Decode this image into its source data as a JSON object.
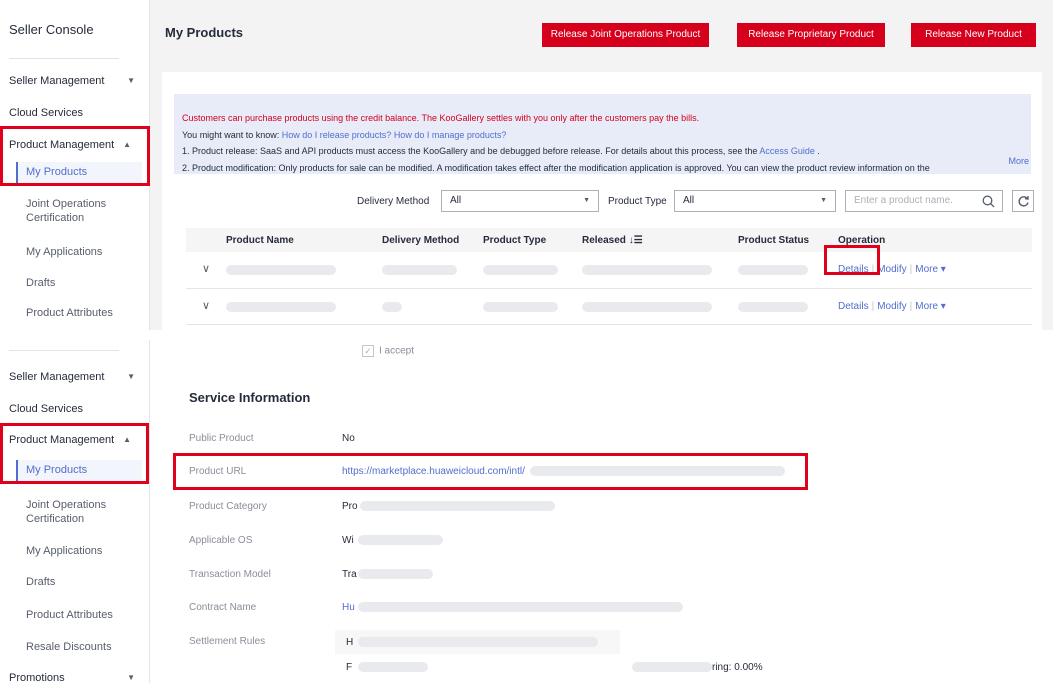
{
  "sidebar": {
    "title": "Seller Console",
    "items": {
      "seller_management": "Seller Management",
      "cloud_services": "Cloud Services",
      "product_management": "Product Management",
      "my_products": "My Products",
      "joint_ops_line1": "Joint Operations",
      "joint_ops_line2": "Certification",
      "my_applications": "My Applications",
      "drafts": "Drafts",
      "product_attributes": "Product Attributes",
      "resale_discounts": "Resale Discounts",
      "promotions": "Promotions"
    },
    "arrow_down": "▼",
    "arrow_up": "▲"
  },
  "header": {
    "title": "My Products",
    "btn_joint": "Release Joint Operations Product",
    "btn_proprietary": "Release Proprietary Product",
    "btn_new": "Release New Product"
  },
  "notice": {
    "line0": "Customers can purchase products using the credit balance. The KooGallery settles with you only after the customers pay the bills.",
    "line1_prefix": "You might want to know: ",
    "line1_link1": "How do I release products?",
    "line1_link2": "How do I manage products?",
    "line2_prefix": "1. Product release: SaaS and API products must access the KooGallery and be debugged before release. For details about this process, see the ",
    "line2_link": "Access Guide",
    "line2_suffix": " .",
    "line3": "2. Product modification: Only products for sale can be modified. A modification takes effect after the modification application is approved. You can view the product review information on the",
    "more": "More"
  },
  "filters": {
    "delivery_label": "Delivery Method",
    "delivery_value": "All",
    "type_label": "Product Type",
    "type_value": "All",
    "search_placeholder": "Enter a product name.",
    "search_icon": "search-icon",
    "refresh_icon": "refresh-icon",
    "caret": "▼"
  },
  "table": {
    "columns": {
      "name": "Product Name",
      "delivery": "Delivery Method",
      "type": "Product Type",
      "released": "Released ↓☰",
      "status": "Product Status",
      "operation": "Operation"
    },
    "rows": [
      {
        "details": "Details",
        "modify": "Modify",
        "more": "More ▾"
      },
      {
        "details": "Details",
        "modify": "Modify",
        "more": "More ▾"
      }
    ],
    "expand_glyph": "∨"
  },
  "accept": "I accept",
  "service": {
    "title": "Service Information",
    "public_product_label": "Public Product",
    "public_product_value": "No",
    "product_url_label": "Product URL",
    "product_url_value": "https://marketplace.huaweicloud.com/intl/",
    "product_category_label": "Product Category",
    "product_category_value": "Pro",
    "applicable_os_label": "Applicable OS",
    "applicable_os_value": "Wi",
    "transaction_model_label": "Transaction Model",
    "transaction_model_value": "Tra",
    "contract_name_label": "Contract Name",
    "contract_name_value": "Hu",
    "settlement_rules_label": "Settlement Rules",
    "settlement_line1": "H",
    "settlement_line2": "F",
    "settlement_rate": "ring: 0.00%"
  },
  "colors": {
    "accent": "#526ecc",
    "brand_red": "#d6001c",
    "highlight": "#e0001b"
  }
}
